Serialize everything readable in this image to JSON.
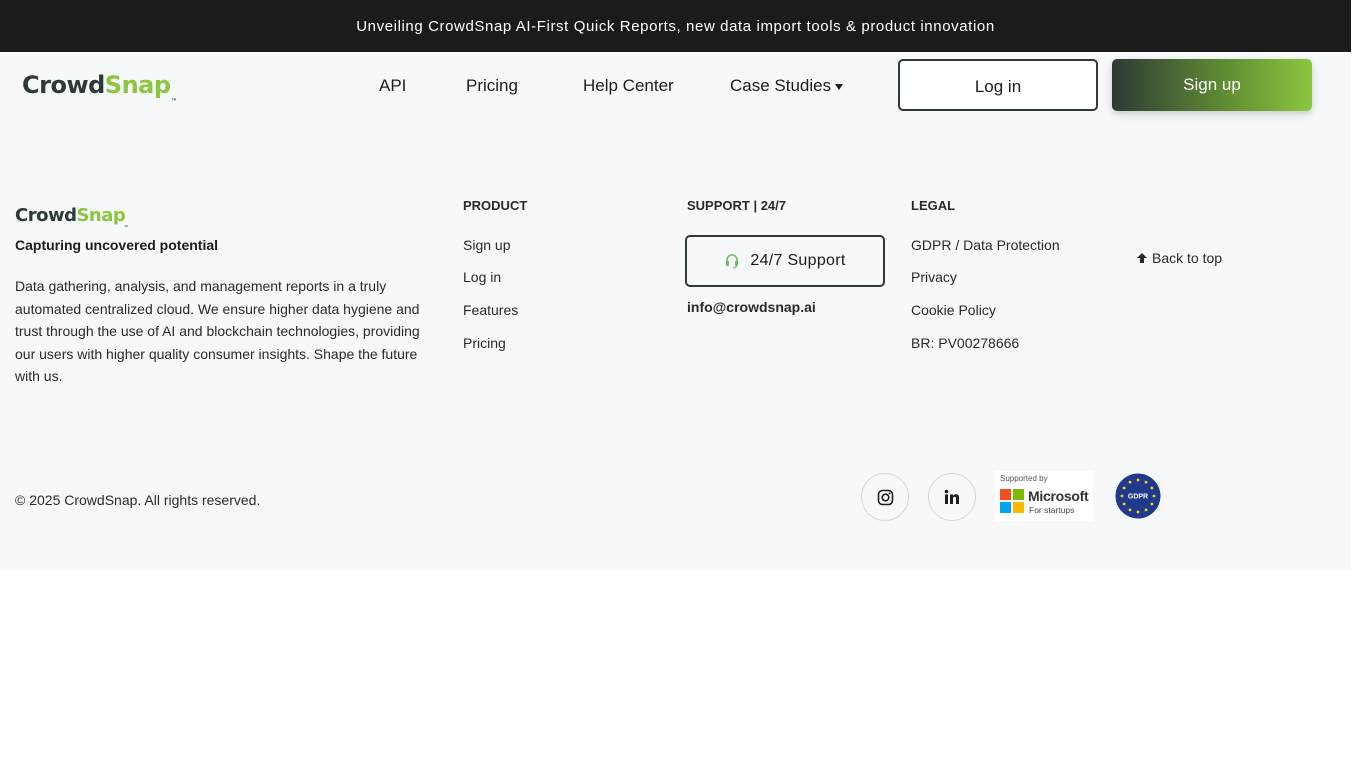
{
  "banner": {
    "text": "Unveiling CrowdSnap AI-First Quick Reports, new data import tools & product innovation"
  },
  "brand": {
    "part1": "Crowd",
    "part2": "Snap",
    "tm": "™",
    "accent": "#8cc63f",
    "dark": "#2e3a35"
  },
  "nav": {
    "links": [
      "API",
      "Pricing",
      "Help Center",
      "Case Studies"
    ],
    "login": "Log in",
    "signup": "Sign up"
  },
  "footer": {
    "tagline": "Capturing uncovered potential",
    "about": "Data gathering, analysis, and management reports in a truly automated centralized cloud. We ensure higher data hygiene and trust through the use of AI and blockchain technologies, providing our users with higher quality consumer insights. Shape the future with us.",
    "product": {
      "heading": "PRODUCT",
      "links": [
        "Sign up",
        "Log in",
        "Features",
        "Pricing"
      ]
    },
    "support": {
      "heading": "SUPPORT | 24/7",
      "button": "24/7 Support",
      "email": "info@crowdsnap.ai"
    },
    "legal": {
      "heading": "LEGAL",
      "links": [
        "GDPR / Data Protection",
        "Privacy",
        "Cookie Policy",
        "BR: PV00278666"
      ]
    },
    "back_to_top": "Back to top",
    "copyright": "© 2025 CrowdSnap. All rights reserved.",
    "microsoft": {
      "supported": "Supported by",
      "name": "Microsoft",
      "sub": "For startups"
    },
    "gdpr_badge": "GDPR",
    "icons": {
      "instagram": "instagram-icon",
      "linkedin": "linkedin-icon",
      "support": "headset-icon",
      "back": "arrow-up-icon"
    }
  }
}
